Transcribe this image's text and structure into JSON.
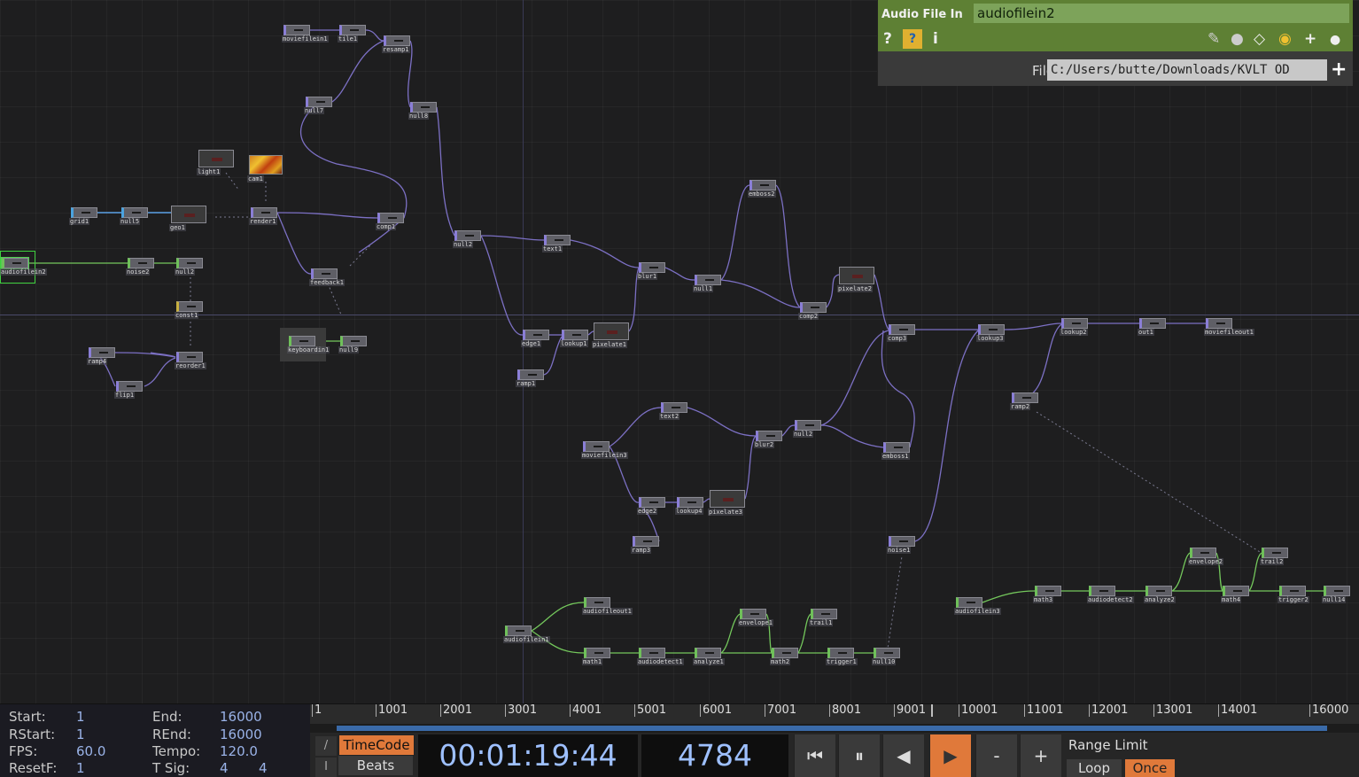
{
  "param_panel": {
    "op_type": "Audio File In",
    "op_name": "audiofilein2",
    "file_label": "File",
    "file_value": "C:/Users/butte/Downloads/KVLT OD",
    "icons": [
      "help-icon",
      "python-help-icon",
      "info-icon",
      "edit-icon",
      "comment-icon",
      "clone-icon",
      "python-icon",
      "add-icon",
      "record-icon"
    ]
  },
  "nodes": [
    {
      "id": "moviefilein1",
      "label": "moviefilein1",
      "family": "top"
    },
    {
      "id": "tile1",
      "label": "tile1",
      "family": "top"
    },
    {
      "id": "resample1",
      "label": "resamp1",
      "family": "top"
    },
    {
      "id": "null7",
      "label": "null7",
      "family": "top"
    },
    {
      "id": "null8",
      "label": "null8",
      "family": "top"
    },
    {
      "id": "light1",
      "label": "light1",
      "family": "top"
    },
    {
      "id": "cam1",
      "label": "cam1",
      "family": "top"
    },
    {
      "id": "grid1",
      "label": "grid1",
      "family": "sop"
    },
    {
      "id": "null5",
      "label": "null5",
      "family": "sop"
    },
    {
      "id": "geo1",
      "label": "geo1",
      "family": "top"
    },
    {
      "id": "render1",
      "label": "render1",
      "family": "top"
    },
    {
      "id": "comp1",
      "label": "comp1",
      "family": "top"
    },
    {
      "id": "audiofilein2",
      "label": "audiofilein2",
      "family": "chop"
    },
    {
      "id": "noise2",
      "label": "noise2",
      "family": "chop"
    },
    {
      "id": "null2",
      "label": "null2",
      "family": "chop"
    },
    {
      "id": "constant1",
      "label": "const1",
      "family": "dat"
    },
    {
      "id": "ramp4",
      "label": "ramp4",
      "family": "top"
    },
    {
      "id": "flip1",
      "label": "flip1",
      "family": "top"
    },
    {
      "id": "reorder1",
      "label": "reorder1",
      "family": "top"
    },
    {
      "id": "feedback1",
      "label": "feedback1",
      "family": "top"
    },
    {
      "id": "keyboardin1",
      "label": "keyboardin1",
      "family": "chop"
    },
    {
      "id": "null9",
      "label": "null9",
      "family": "chop"
    },
    {
      "id": "null12",
      "label": "null2",
      "family": "top"
    },
    {
      "id": "text1",
      "label": "text1",
      "family": "top"
    },
    {
      "id": "blur1",
      "label": "blur1",
      "family": "top"
    },
    {
      "id": "null11",
      "label": "null1",
      "family": "top"
    },
    {
      "id": "emboss2",
      "label": "emboss2",
      "family": "top"
    },
    {
      "id": "comp2",
      "label": "comp2",
      "family": "top"
    },
    {
      "id": "pixelate2",
      "label": "pixelate2",
      "family": "top"
    },
    {
      "id": "edge1",
      "label": "edge1",
      "family": "top"
    },
    {
      "id": "lookup1",
      "label": "lookup1",
      "family": "top"
    },
    {
      "id": "pixelate1",
      "label": "pixelate1",
      "family": "top"
    },
    {
      "id": "ramp1",
      "label": "ramp1",
      "family": "top"
    },
    {
      "id": "comp3",
      "label": "comp3",
      "family": "top"
    },
    {
      "id": "lookup3",
      "label": "lookup3",
      "family": "top"
    },
    {
      "id": "lookup2",
      "label": "lookup2",
      "family": "top"
    },
    {
      "id": "out1",
      "label": "out1",
      "family": "top"
    },
    {
      "id": "moviefileout1",
      "label": "moviefileout1",
      "family": "top"
    },
    {
      "id": "ramp2",
      "label": "ramp2",
      "family": "top"
    },
    {
      "id": "moviefilein3",
      "label": "moviefilein3",
      "family": "top"
    },
    {
      "id": "text2",
      "label": "text2",
      "family": "top"
    },
    {
      "id": "blur2",
      "label": "blur2",
      "family": "top"
    },
    {
      "id": "null13",
      "label": "null2",
      "family": "top"
    },
    {
      "id": "emboss1",
      "label": "emboss1",
      "family": "top"
    },
    {
      "id": "edge2",
      "label": "edge2",
      "family": "top"
    },
    {
      "id": "lookup4",
      "label": "lookup4",
      "family": "top"
    },
    {
      "id": "pixelate3",
      "label": "pixelate3",
      "family": "top"
    },
    {
      "id": "ramp3",
      "label": "ramp3",
      "family": "top"
    },
    {
      "id": "noise1",
      "label": "noise1",
      "family": "top"
    },
    {
      "id": "audiofileout1",
      "label": "audiofileout1",
      "family": "chop"
    },
    {
      "id": "audiofilein1",
      "label": "audiofilein1",
      "family": "chop"
    },
    {
      "id": "math1",
      "label": "math1",
      "family": "chop"
    },
    {
      "id": "audiodetect1",
      "label": "audiodetect1",
      "family": "chop"
    },
    {
      "id": "analyze1",
      "label": "analyze1",
      "family": "chop"
    },
    {
      "id": "envelope1",
      "label": "envelope1",
      "family": "chop"
    },
    {
      "id": "math2",
      "label": "math2",
      "family": "chop"
    },
    {
      "id": "trail1",
      "label": "trail1",
      "family": "chop"
    },
    {
      "id": "trigger1",
      "label": "trigger1",
      "family": "chop"
    },
    {
      "id": "null10",
      "label": "null10",
      "family": "chop"
    },
    {
      "id": "audiofilein3",
      "label": "audiofilein3",
      "family": "chop"
    },
    {
      "id": "math3",
      "label": "math3",
      "family": "chop"
    },
    {
      "id": "audiodetect2",
      "label": "audiodetect2",
      "family": "chop"
    },
    {
      "id": "analyze2",
      "label": "analyze2",
      "family": "chop"
    },
    {
      "id": "envelope2",
      "label": "envelope2",
      "family": "chop"
    },
    {
      "id": "math4",
      "label": "math4",
      "family": "chop"
    },
    {
      "id": "trigger2",
      "label": "trigger2",
      "family": "chop"
    },
    {
      "id": "trail2",
      "label": "trail2",
      "family": "chop"
    },
    {
      "id": "null14",
      "label": "null14",
      "family": "chop"
    }
  ],
  "timeline": {
    "start_label": "Start:",
    "start": "1",
    "end_label": "End:",
    "end": "16000",
    "rstart_label": "RStart:",
    "rstart": "1",
    "rend_label": "REnd:",
    "rend": "16000",
    "fps_label": "FPS:",
    "fps": "60.0",
    "tempo_label": "Tempo:",
    "tempo": "120.0",
    "resetf_label": "ResetF:",
    "resetf": "1",
    "tsig_label": "T Sig:",
    "tsig_a": "4",
    "tsig_b": "4",
    "ticks": [
      "1",
      "1001",
      "2001",
      "3001",
      "4001",
      "5001",
      "6001",
      "7001",
      "8001",
      "9001",
      "10001",
      "11001",
      "12001",
      "13001",
      "14001",
      "16000"
    ],
    "timecode_label": "TimeCode",
    "beats_label": "Beats",
    "timecode": "00:01:19:44",
    "frame": "4784",
    "range_limit_label": "Range Limit",
    "loop_label": "Loop",
    "once_label": "Once",
    "minus": "-",
    "plus": "+"
  }
}
